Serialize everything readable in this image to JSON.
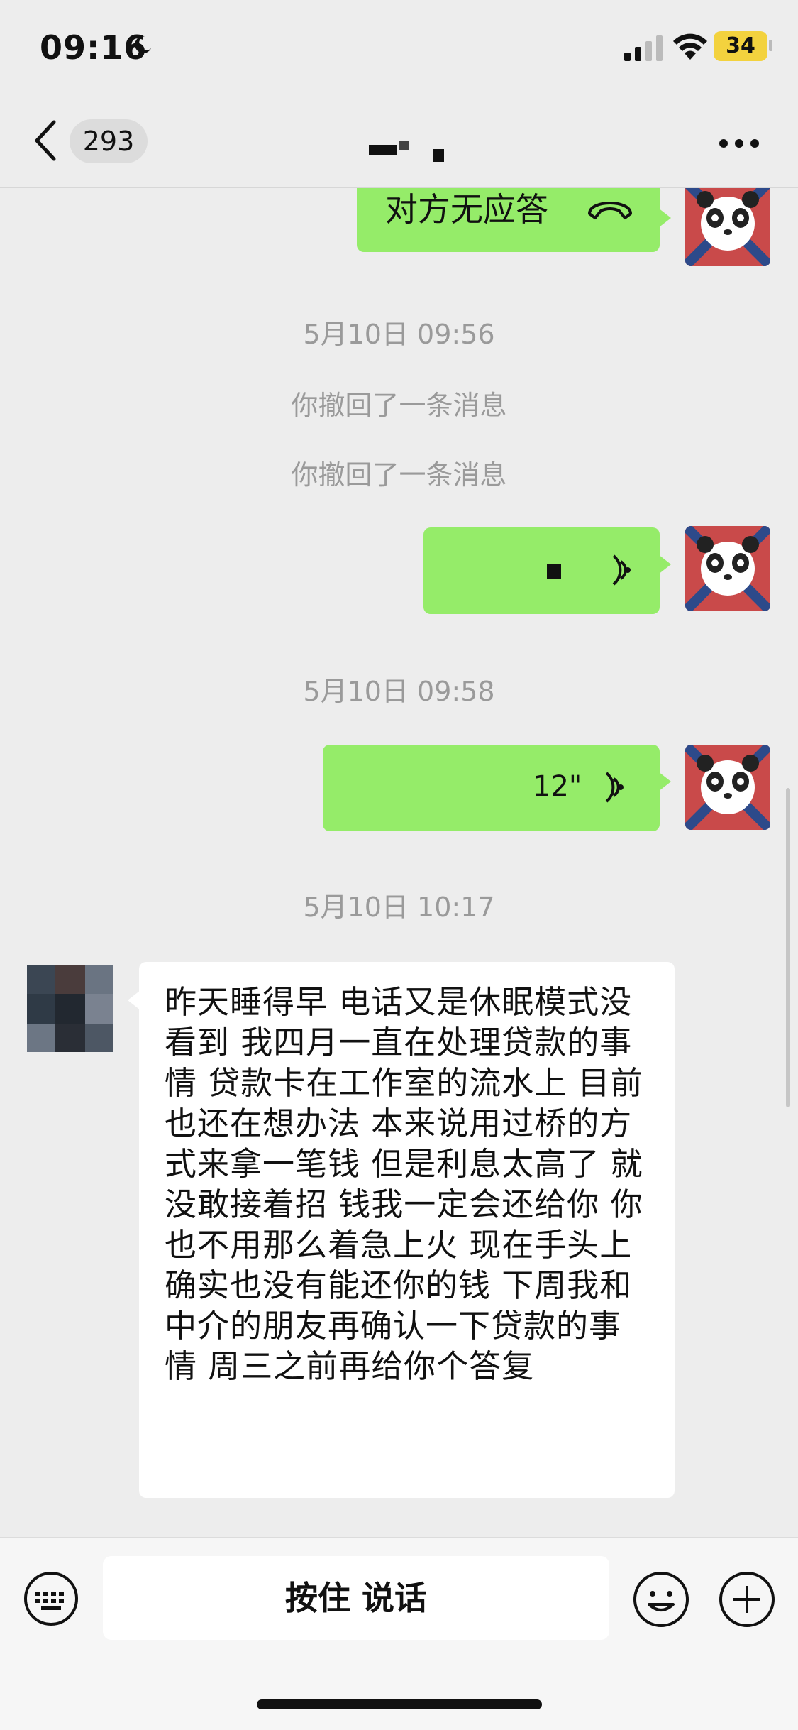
{
  "status_bar": {
    "time": "09:16",
    "battery": "34",
    "icons": [
      "moon-icon",
      "signal-icon",
      "wifi-icon",
      "battery-icon"
    ]
  },
  "nav": {
    "unread_count": "293",
    "contact_name": "",
    "icons": [
      "back-chevron-icon",
      "more-dots-icon"
    ]
  },
  "messages": {
    "call_status": "对方无应答",
    "stamp1": "5月10日 09:56",
    "recall1": "你撤回了一条消息",
    "recall2": "你撤回了一条消息",
    "stamp2": "5月10日 09:58",
    "voice2_duration": "12\"",
    "stamp3": "5月10日 10:17",
    "incoming_text": "昨天睡得早 电话又是休眠模式没看到 我四月一直在处理贷款的事情 贷款卡在工作室的流水上 目前也还在想办法 本来说用过桥的方式来拿一笔钱 但是利息太高了 就没敢接着招 钱我一定会还给你 你也不用那么着急上火 现在手头上确实也没有能还你的钱 下周我和中介的朋友再确认一下贷款的事情 周三之前再给你个答复"
  },
  "input_bar": {
    "hold_to_talk": "按住 说话",
    "icons": [
      "keyboard-icon",
      "emoji-icon",
      "plus-icon"
    ]
  },
  "colors": {
    "outgoing_bubble": "#95ec69",
    "incoming_bubble": "#ffffff",
    "background": "#ededed",
    "battery": "#f3d23e"
  }
}
